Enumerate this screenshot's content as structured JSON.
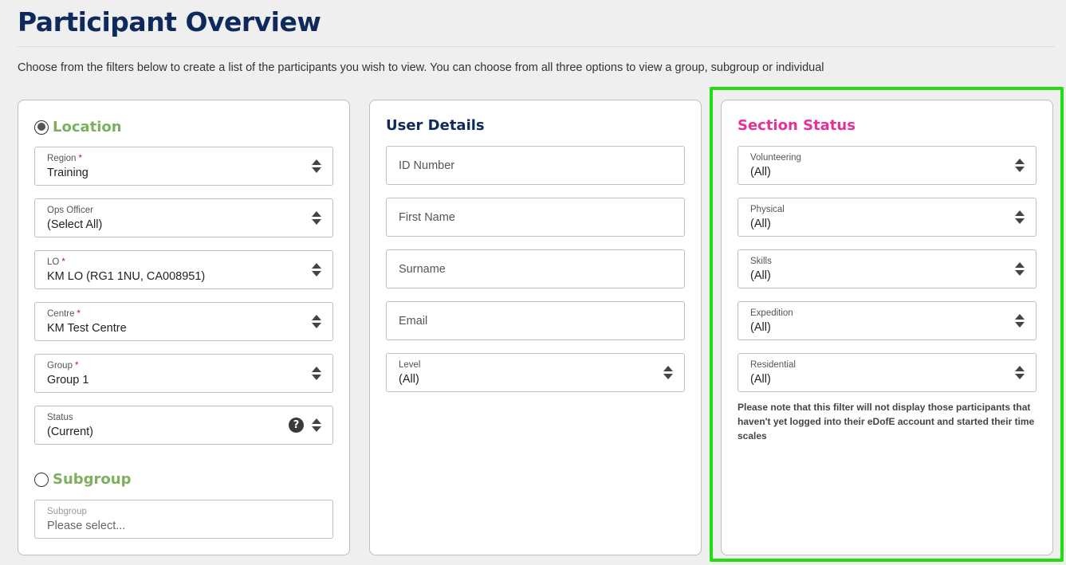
{
  "page": {
    "title": "Participant Overview",
    "intro": "Choose from the filters below to create a list of the participants you wish to view. You can choose from all three options to view a group, subgroup or individual"
  },
  "location_panel": {
    "location_radio_label": "Location",
    "location_checked": true,
    "fields": [
      {
        "label": "Region",
        "required": true,
        "value": "Training",
        "icon": "sort-icon"
      },
      {
        "label": "Ops Officer",
        "required": false,
        "value": "(Select All)",
        "icon": "sort-icon"
      },
      {
        "label": "LO",
        "required": true,
        "value": "KM LO (RG1 1NU, CA008951)",
        "icon": "sort-icon"
      },
      {
        "label": "Centre",
        "required": true,
        "value": "KM Test Centre",
        "icon": "sort-icon"
      },
      {
        "label": "Group",
        "required": true,
        "value": "Group 1",
        "icon": "sort-icon"
      },
      {
        "label": "Status",
        "required": false,
        "value": "(Current)",
        "icon": "sort-icon",
        "help_icon": "?"
      }
    ],
    "subgroup_radio_label": "Subgroup",
    "subgroup_checked": false,
    "subgroup_field": {
      "label": "Subgroup",
      "placeholder": "Please select..."
    },
    "required_mark": "*"
  },
  "user_details_panel": {
    "heading": "User Details",
    "inputs": [
      {
        "placeholder": "ID Number"
      },
      {
        "placeholder": "First Name"
      },
      {
        "placeholder": "Surname"
      },
      {
        "placeholder": "Email"
      }
    ],
    "level": {
      "label": "Level",
      "value": "(All)"
    }
  },
  "section_status_panel": {
    "heading": "Section Status",
    "fields": [
      {
        "label": "Volunteering",
        "value": "(All)"
      },
      {
        "label": "Physical",
        "value": "(All)"
      },
      {
        "label": "Skills",
        "value": "(All)"
      },
      {
        "label": "Expedition",
        "value": "(All)"
      },
      {
        "label": "Residential",
        "value": "(All)"
      }
    ],
    "note": "Please note that this filter will not display those participants that haven't yet logged into their eDofE account and started their time scales"
  },
  "colors": {
    "title": "#0e2a5c",
    "location_green": "#7cb05f",
    "section_pink": "#e7309a",
    "highlight_green": "#22dd11",
    "required_red": "#c8102e"
  }
}
